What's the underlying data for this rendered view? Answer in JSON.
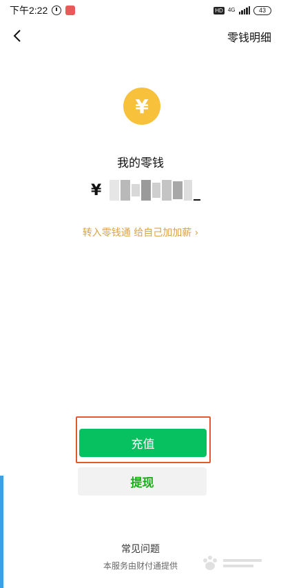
{
  "status_bar": {
    "time": "下午2:22",
    "hd": "HD",
    "network": "4G",
    "battery": "43",
    "icons": [
      "alarm-icon",
      "app-badge-icon",
      "signal-icon",
      "battery-icon"
    ]
  },
  "nav": {
    "back_icon": "chevron-left-icon",
    "action_label": "零钱明细"
  },
  "wallet": {
    "coin_icon": "yen-coin-icon",
    "coin_symbol": "¥",
    "title": "我的零钱",
    "currency_symbol": "¥",
    "balance_visibility": "obscured",
    "promo_text": "转入零钱通 给自己加加薪 ›"
  },
  "actions": {
    "recharge_label": "充值",
    "withdraw_label": "提现"
  },
  "footer": {
    "faq_label": "常见问题",
    "provider_note": "本服务由财付通提供"
  },
  "colors": {
    "accent_green": "#07c160",
    "withdraw_text": "#1aad19",
    "promo_gold": "#d9a24a",
    "coin_yellow": "#f7c13c",
    "highlight_red": "#e4572e"
  }
}
